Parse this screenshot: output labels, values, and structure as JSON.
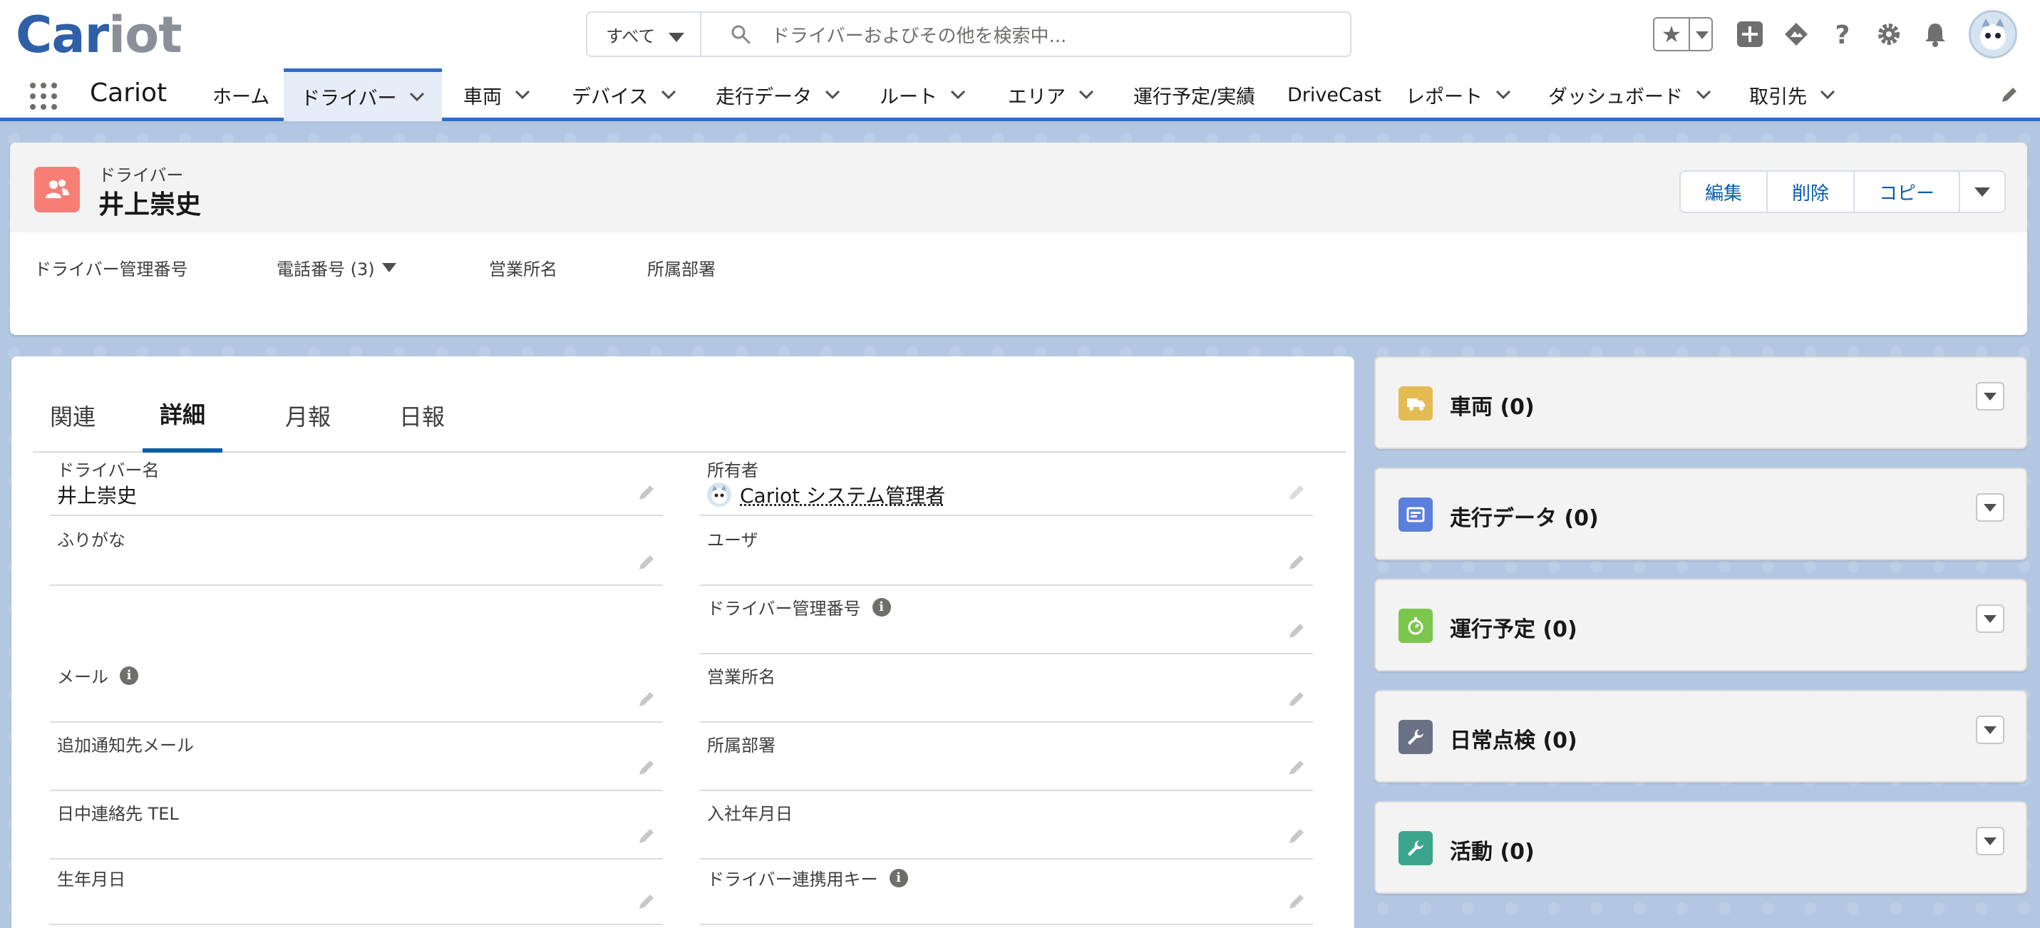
{
  "header": {
    "logo_a": "Car",
    "logo_b": "iot",
    "search_scope": "すべて",
    "search_placeholder": "ドライバーおよびその他を検索中..."
  },
  "nav": {
    "app_name": "Cariot",
    "items": [
      {
        "label": "ホーム",
        "has_menu": false
      },
      {
        "label": "ドライバー",
        "has_menu": true,
        "active": true
      },
      {
        "label": "車両",
        "has_menu": true
      },
      {
        "label": "デバイス",
        "has_menu": true
      },
      {
        "label": "走行データ",
        "has_menu": true
      },
      {
        "label": "ルート",
        "has_menu": true
      },
      {
        "label": "エリア",
        "has_menu": true
      },
      {
        "label": "運行予定/実績",
        "has_menu": false
      },
      {
        "label": "DriveCast",
        "has_menu": false
      },
      {
        "label": "レポート",
        "has_menu": true
      },
      {
        "label": "ダッシュボード",
        "has_menu": true
      },
      {
        "label": "取引先",
        "has_menu": true
      }
    ]
  },
  "record": {
    "object_label": "ドライバー",
    "name": "井上崇史",
    "actions": {
      "edit": "編集",
      "delete": "削除",
      "copy": "コピー"
    },
    "highlights": {
      "driver_number": "ドライバー管理番号",
      "phone": "電話番号 (3)",
      "office": "営業所名",
      "department": "所属部署"
    }
  },
  "tabs": [
    "関連",
    "詳細",
    "月報",
    "日報"
  ],
  "active_tab": "詳細",
  "fields": {
    "driver_name": {
      "label": "ドライバー名",
      "value": "井上崇史"
    },
    "owner": {
      "label": "所有者",
      "value": "Cariot システム管理者"
    },
    "furigana": {
      "label": "ふりがな",
      "value": ""
    },
    "user": {
      "label": "ユーザ",
      "value": ""
    },
    "driver_number": {
      "label": "ドライバー管理番号",
      "value": ""
    },
    "email": {
      "label": "メール",
      "value": ""
    },
    "office": {
      "label": "営業所名",
      "value": ""
    },
    "extra_email": {
      "label": "追加通知先メール",
      "value": ""
    },
    "department": {
      "label": "所属部署",
      "value": ""
    },
    "day_tel": {
      "label": "日中連絡先 TEL",
      "value": ""
    },
    "join_date": {
      "label": "入社年月日",
      "value": ""
    },
    "birth_date": {
      "label": "生年月日",
      "value": ""
    },
    "link_key": {
      "label": "ドライバー連携用キー",
      "value": ""
    }
  },
  "related": [
    {
      "title": "車両 (0)",
      "icon": "truck-icon",
      "color": "#e4bb52"
    },
    {
      "title": "走行データ (0)",
      "icon": "document-icon",
      "color": "#5a7fdc"
    },
    {
      "title": "運行予定 (0)",
      "icon": "stopwatch-icon",
      "color": "#7cc64d"
    },
    {
      "title": "日常点検 (0)",
      "icon": "wrench-icon",
      "color": "#6b7185"
    },
    {
      "title": "活動 (0)",
      "icon": "wrench-icon",
      "color": "#3ba68b"
    }
  ],
  "colors": {
    "brand": "#2f6dc9",
    "link": "#0b5cab",
    "record_icon": "#f77e75"
  }
}
